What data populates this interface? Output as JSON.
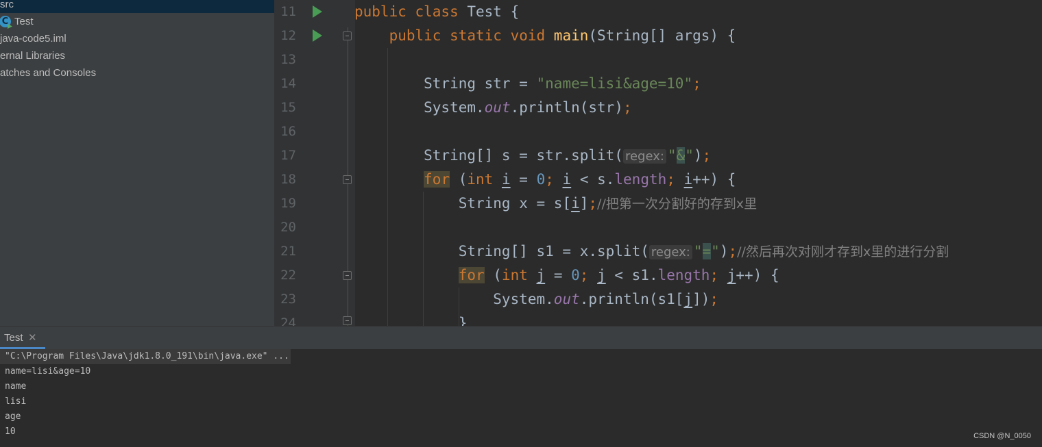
{
  "project_tree": {
    "items": [
      {
        "label": "src"
      },
      {
        "label": "Test"
      },
      {
        "label": "java-code5.iml"
      },
      {
        "label": "ernal Libraries"
      },
      {
        "label": "atches and Consoles"
      }
    ]
  },
  "editor": {
    "line_numbers": [
      "11",
      "12",
      "13",
      "14",
      "15",
      "16",
      "17",
      "18",
      "19",
      "20",
      "21",
      "22",
      "23",
      "24"
    ],
    "hint_label": "regex:",
    "comments": {
      "line19": "//把第一次分割好的存到x里",
      "line21": "//然后再次对刚才存到x里的进行分割"
    }
  },
  "run_panel": {
    "tab_label": "Test",
    "close_glyph": "✕",
    "console": [
      "\"C:\\Program Files\\Java\\jdk1.8.0_191\\bin\\java.exe\" ...",
      "name=lisi&age=10",
      "name",
      "lisi",
      "age",
      "10"
    ]
  },
  "watermark": "CSDN @N_0050",
  "icons": {
    "class_icon": "java-class-icon",
    "run_icon": "run-gutter-icon",
    "fold_icon": "fold-marker-icon",
    "close_icon": "close-icon"
  },
  "colors": {
    "keyword": "#cc7832",
    "string": "#6a8759",
    "function": "#ffc66d",
    "field": "#9876aa",
    "number": "#6897bb",
    "comment": "#808080",
    "selection": "#0d293e"
  }
}
